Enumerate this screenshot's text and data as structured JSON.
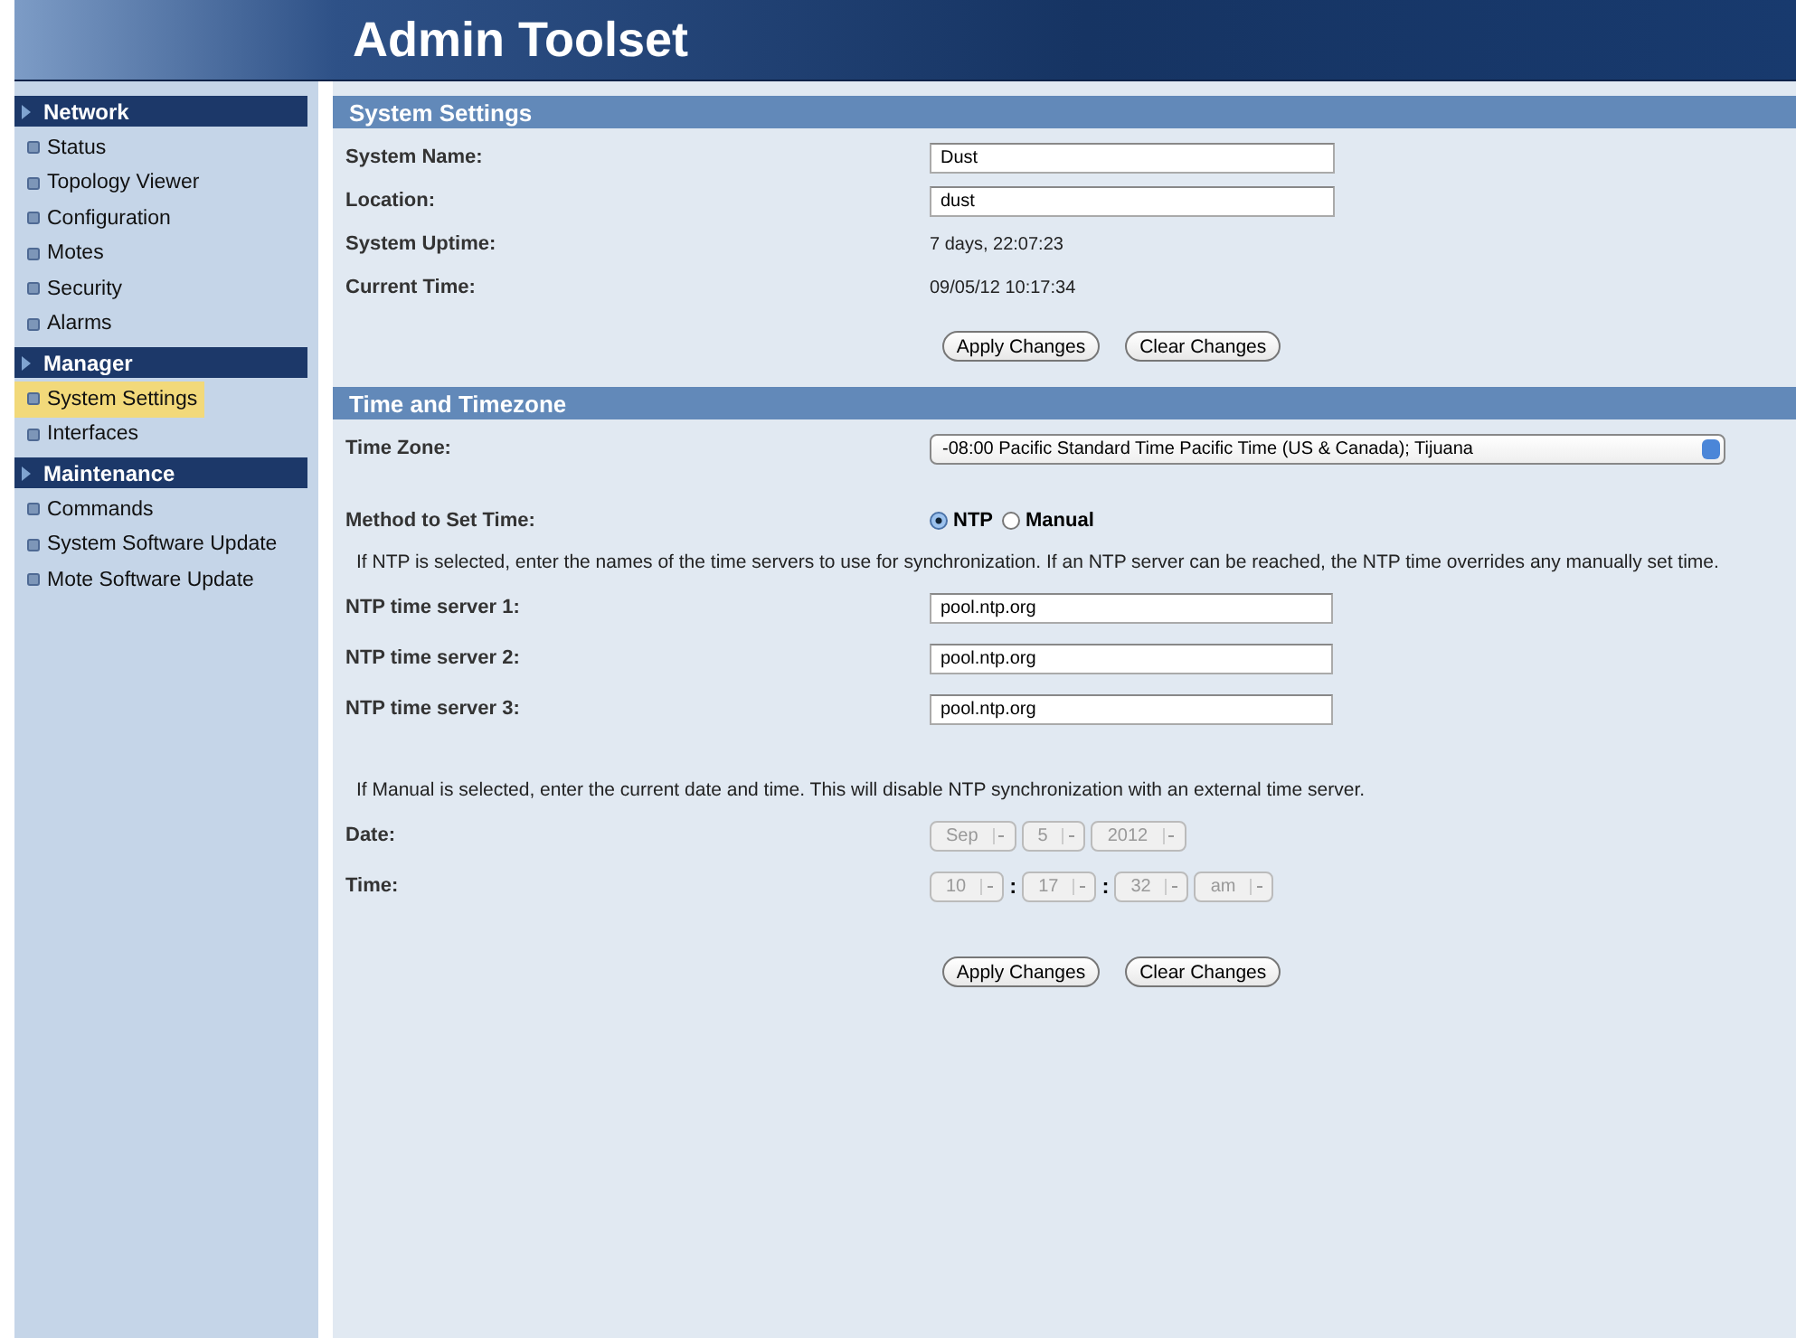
{
  "header": {
    "title": "Admin Toolset"
  },
  "sidebar": {
    "sections": [
      {
        "title": "Network",
        "items": [
          {
            "label": "Status",
            "selected": false
          },
          {
            "label": "Topology Viewer",
            "selected": false
          },
          {
            "label": "Configuration",
            "selected": false
          },
          {
            "label": "Motes",
            "selected": false
          },
          {
            "label": "Security",
            "selected": false
          },
          {
            "label": "Alarms",
            "selected": false
          }
        ]
      },
      {
        "title": "Manager",
        "items": [
          {
            "label": "System Settings",
            "selected": true
          },
          {
            "label": "Interfaces",
            "selected": false
          }
        ]
      },
      {
        "title": "Maintenance",
        "items": [
          {
            "label": "Commands",
            "selected": false
          },
          {
            "label": "System Software Update",
            "selected": false
          },
          {
            "label": "Mote Software Update",
            "selected": false
          }
        ]
      }
    ]
  },
  "system_settings": {
    "title": "System Settings",
    "fields": [
      {
        "kind": "input",
        "label": "System Name:",
        "value": "Dust"
      },
      {
        "kind": "input",
        "label": "Location:",
        "value": "dust"
      },
      {
        "kind": "text",
        "label": "System Uptime:",
        "value": "7 days, 22:07:23"
      },
      {
        "kind": "text",
        "label": "Current Time:",
        "value": "09/05/12 10:17:34"
      }
    ],
    "buttons": [
      "Apply Changes",
      "Clear Changes"
    ]
  },
  "time_and_timezone": {
    "title": "Time and Timezone",
    "time_zone": {
      "label": "Time Zone:",
      "value": "-08:00 Pacific Standard Time Pacific Time (US & Canada); Tijuana"
    },
    "method": {
      "label": "Method to Set Time:",
      "options": [
        {
          "label": "NTP",
          "selected": true
        },
        {
          "label": "Manual",
          "selected": false
        }
      ]
    },
    "ntp_note": "If NTP is selected, enter the names of the time servers to use for synchronization. If an NTP server can be reached, the NTP time overrides any manually set time.",
    "ntp_servers": [
      {
        "label": "NTP time server 1:",
        "value": "pool.ntp.org"
      },
      {
        "label": "NTP time server 2:",
        "value": "pool.ntp.org"
      },
      {
        "label": "NTP time server 3:",
        "value": "pool.ntp.org"
      }
    ],
    "manual_note": "If Manual is selected, enter the current date and time. This will disable NTP synchronization with an external time server.",
    "date": {
      "label": "Date:",
      "disabled": true,
      "parts": [
        {
          "kind": "select",
          "value": "Sep"
        },
        {
          "kind": "select",
          "value": "5"
        },
        {
          "kind": "select",
          "value": "2012"
        }
      ]
    },
    "time": {
      "label": "Time:",
      "disabled": true,
      "parts": [
        {
          "kind": "select",
          "value": "10"
        },
        {
          "kind": "separator",
          "value": ":"
        },
        {
          "kind": "select",
          "value": "17"
        },
        {
          "kind": "separator",
          "value": ":"
        },
        {
          "kind": "select",
          "value": "32"
        },
        {
          "kind": "select",
          "value": "am"
        }
      ]
    },
    "buttons": [
      "Apply Changes",
      "Clear Changes"
    ]
  }
}
